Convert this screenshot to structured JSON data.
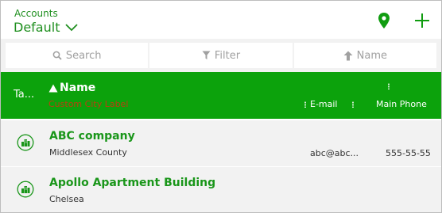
{
  "header": {
    "accounts_label": "Accounts",
    "view_value": "Default",
    "pin_icon": "map-pin-icon",
    "add_icon": "plus-icon"
  },
  "toolbar": {
    "search_label": "Search",
    "filter_label": "Filter",
    "sort_label": "Name"
  },
  "columns": {
    "tag_label": "Ta...",
    "name_label": "Name",
    "sub_label": "Custom City Label",
    "email_label": "E-mail",
    "phone_label": "Main Phone"
  },
  "rows": [
    {
      "title": "ABC company",
      "subtitle": "Middlesex County",
      "email": "abc@abc...",
      "phone": "555-55-55",
      "icon": "building-icon"
    },
    {
      "title": "Apollo Apartment Building",
      "subtitle": "Chelsea",
      "email": "",
      "phone": "",
      "icon": "building-icon"
    }
  ],
  "colors": {
    "accent": "#0ca20c",
    "accent_text": "#1a961a",
    "header_sub_label": "#b7400f",
    "toolbar_bg": "#f2f2f2"
  }
}
